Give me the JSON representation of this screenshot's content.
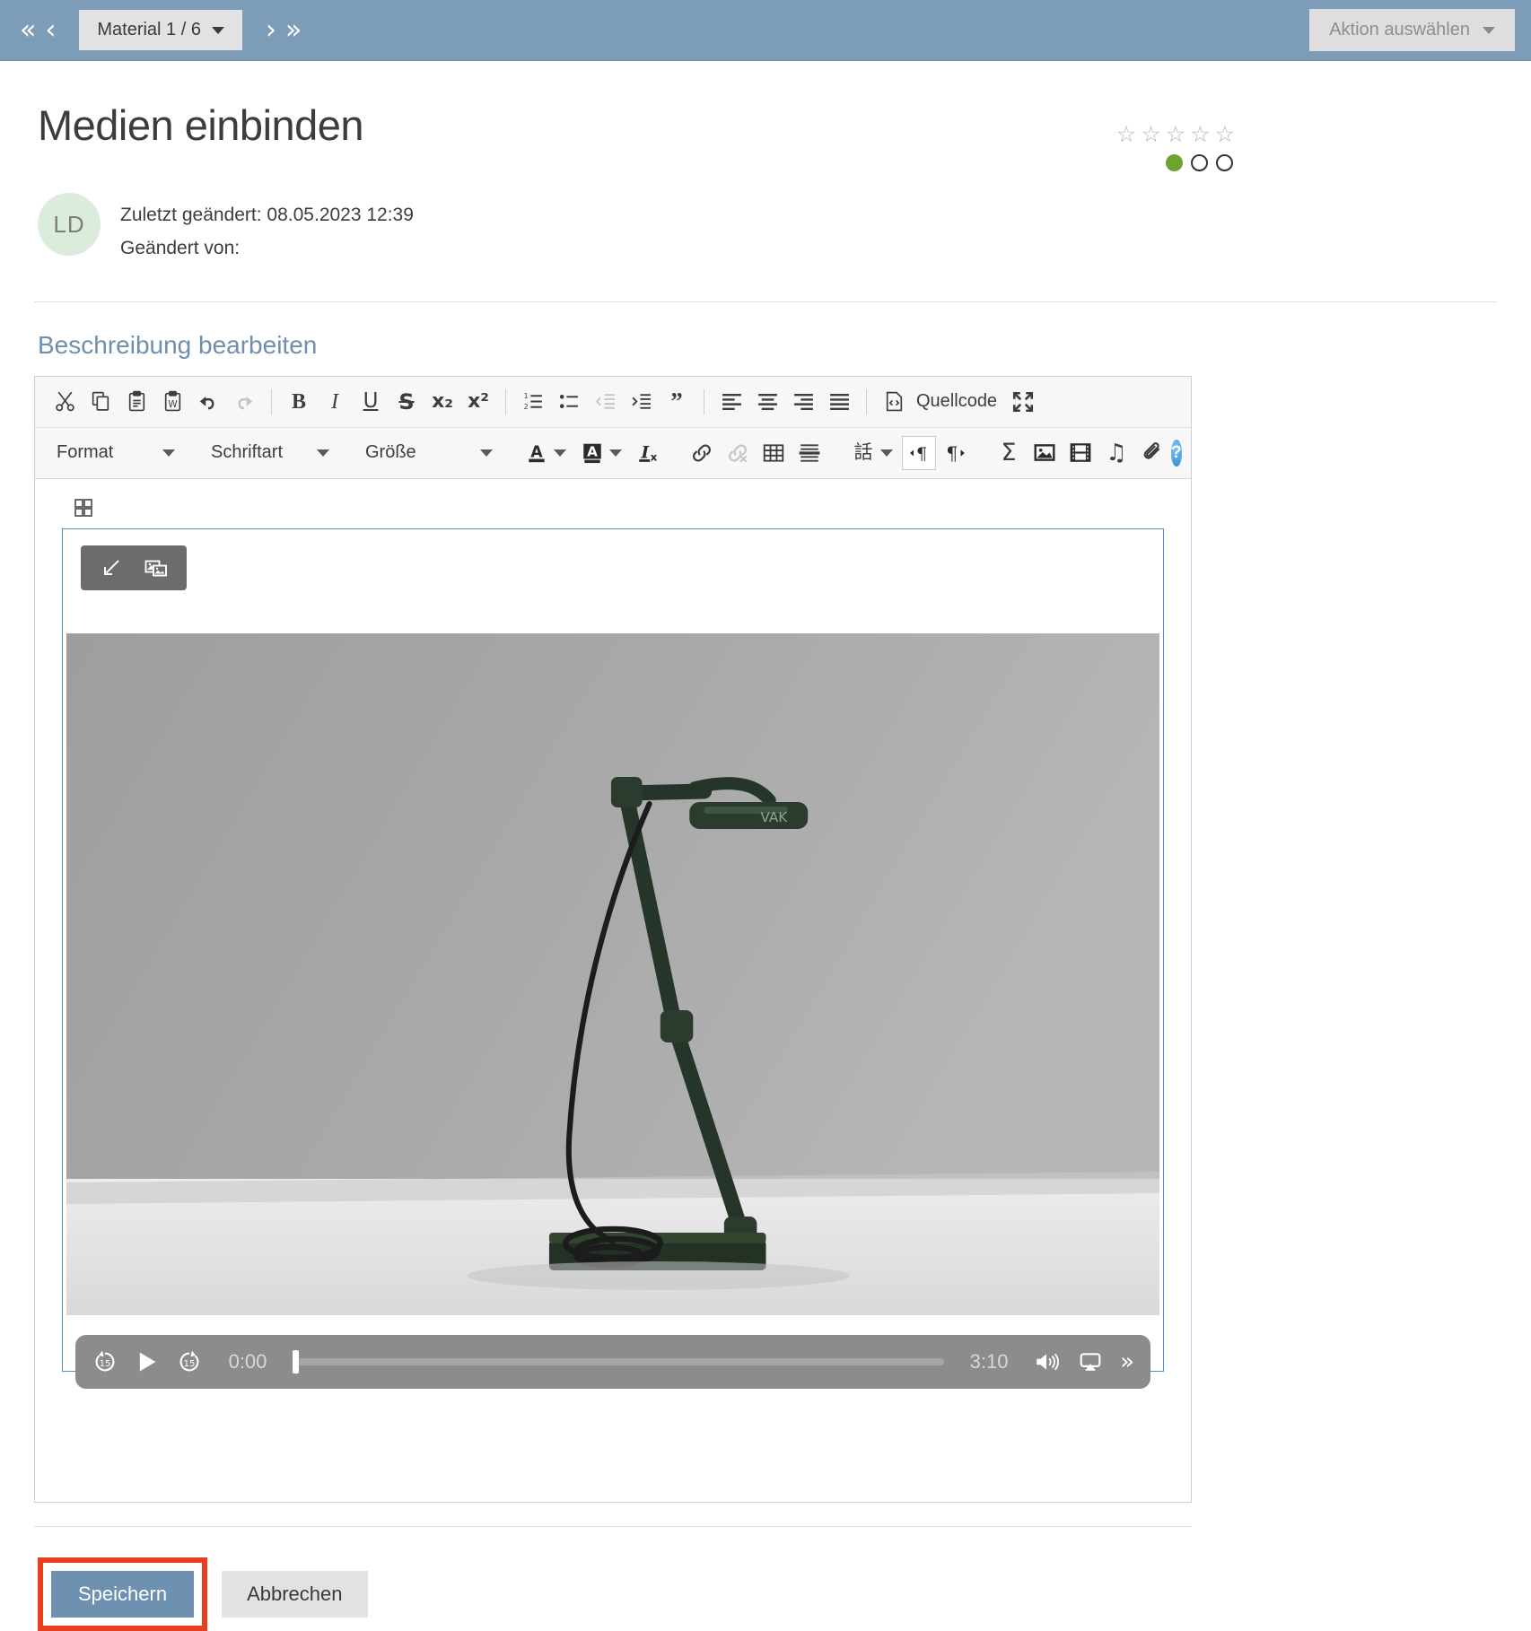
{
  "topbar": {
    "first_icon": "double-chevron-left-icon",
    "prev_icon": "chevron-left-icon",
    "next_icon": "chevron-right-icon",
    "last_icon": "double-chevron-right-icon",
    "first_label": "«",
    "prev_label": "‹",
    "next_label": "›",
    "last_label": "»",
    "material_label": "Material 1 / 6",
    "action_label": "Aktion auswählen"
  },
  "header": {
    "title": "Medien einbinden",
    "stars": [
      "☆",
      "☆",
      "☆",
      "☆",
      "☆"
    ],
    "dots": [
      "filled",
      "empty",
      "empty"
    ],
    "dot_color": "#6fa230",
    "avatar_initials": "LD",
    "avatar_bg": "#dcecdc",
    "modified_line": "Zuletzt geändert: 08.05.2023 12:39",
    "modified_by_line": "Geändert von:"
  },
  "section": {
    "label": "Beschreibung bearbeiten",
    "label_color": "#6e8fae"
  },
  "toolbar": {
    "row1": [
      {
        "name": "cut-icon",
        "label": "Ausschneiden",
        "dim": false
      },
      {
        "name": "copy-icon",
        "label": "Kopieren",
        "dim": false
      },
      {
        "name": "paste-icon",
        "label": "Einfügen",
        "dim": false
      },
      {
        "name": "paste-from-word-icon",
        "label": "Aus Word einfügen",
        "dim": false
      },
      {
        "name": "undo-icon",
        "label": "Rückgängig",
        "dim": false
      },
      {
        "name": "redo-icon",
        "label": "Wiederholen",
        "dim": true
      },
      {
        "name": "bold-icon",
        "label": "B",
        "dim": false
      },
      {
        "name": "italic-icon",
        "label": "I",
        "dim": false
      },
      {
        "name": "underline-icon",
        "label": "U",
        "dim": false
      },
      {
        "name": "strikethrough-icon",
        "label": "S",
        "dim": false
      },
      {
        "name": "subscript-icon",
        "label": "x₂",
        "dim": false
      },
      {
        "name": "superscript-icon",
        "label": "x²",
        "dim": false
      },
      {
        "name": "numbered-list-icon",
        "label": "Nummerierte Liste",
        "dim": false
      },
      {
        "name": "bulleted-list-icon",
        "label": "Aufzählung",
        "dim": false
      },
      {
        "name": "outdent-icon",
        "label": "Einzug verkleinern",
        "dim": true
      },
      {
        "name": "indent-icon",
        "label": "Einzug vergrößern",
        "dim": false
      },
      {
        "name": "blockquote-icon",
        "label": "Zitat",
        "dim": false
      },
      {
        "name": "align-left-icon",
        "label": "Linksbündig",
        "dim": false
      },
      {
        "name": "align-center-icon",
        "label": "Zentriert",
        "dim": false
      },
      {
        "name": "align-right-icon",
        "label": "Rechtsbündig",
        "dim": false
      },
      {
        "name": "justify-icon",
        "label": "Blocksatz",
        "dim": false
      },
      {
        "name": "source-code-icon",
        "label": "Quellcode",
        "dim": false
      },
      {
        "name": "maximize-icon",
        "label": "Maximieren",
        "dim": false
      }
    ],
    "source_label": "Quellcode",
    "format_label": "Format",
    "font_label": "Schriftart",
    "size_label": "Größe",
    "row2": [
      {
        "name": "text-color-icon",
        "label": "Textfarbe",
        "dim": false
      },
      {
        "name": "background-color-icon",
        "label": "Hintergrundfarbe",
        "dim": false
      },
      {
        "name": "remove-format-icon",
        "label": "Formatierung entfernen",
        "dim": false
      },
      {
        "name": "link-icon",
        "label": "Link einfügen",
        "dim": false
      },
      {
        "name": "unlink-icon",
        "label": "Link entfernen",
        "dim": true
      },
      {
        "name": "table-icon",
        "label": "Tabelle",
        "dim": false
      },
      {
        "name": "horizontal-rule-icon",
        "label": "Horizontale Linie",
        "dim": false
      },
      {
        "name": "language-icon",
        "label": "Sprache",
        "dim": false
      },
      {
        "name": "text-direction-ltr-icon",
        "label": "Textrichtung links nach rechts",
        "dim": false
      },
      {
        "name": "text-direction-rtl-icon",
        "label": "Textrichtung rechts nach links",
        "dim": false
      },
      {
        "name": "formula-icon",
        "label": "Formel",
        "dim": false
      },
      {
        "name": "image-icon",
        "label": "Bild",
        "dim": false
      },
      {
        "name": "video-icon",
        "label": "Video",
        "dim": false
      },
      {
        "name": "audio-icon",
        "label": "Audio",
        "dim": false
      },
      {
        "name": "attachment-icon",
        "label": "Anhang",
        "dim": false
      },
      {
        "name": "help-icon",
        "label": "?",
        "dim": false
      }
    ],
    "help_glyph": "?"
  },
  "widget": {
    "resize_icon": "resize-handle-icon",
    "image_props_icon": "image-properties-icon",
    "table_handle_icon": "table-handle-icon",
    "border_color": "#4a90d9"
  },
  "player": {
    "rewind_label": "15",
    "forward_label": "15",
    "play_icon": "play-icon",
    "rewind_icon": "rewind-15-icon",
    "forward_icon": "forward-15-icon",
    "current_time": "0:00",
    "total_time": "3:10",
    "volume_icon": "volume-icon",
    "airplay_icon": "airplay-icon",
    "more_icon": "more-chevrons-icon",
    "more_label": "»",
    "progress_percent": 0
  },
  "footer": {
    "save_label": "Speichern",
    "cancel_label": "Abbrechen",
    "highlight_color": "#e8401f",
    "save_bg": "#6e91b2"
  }
}
